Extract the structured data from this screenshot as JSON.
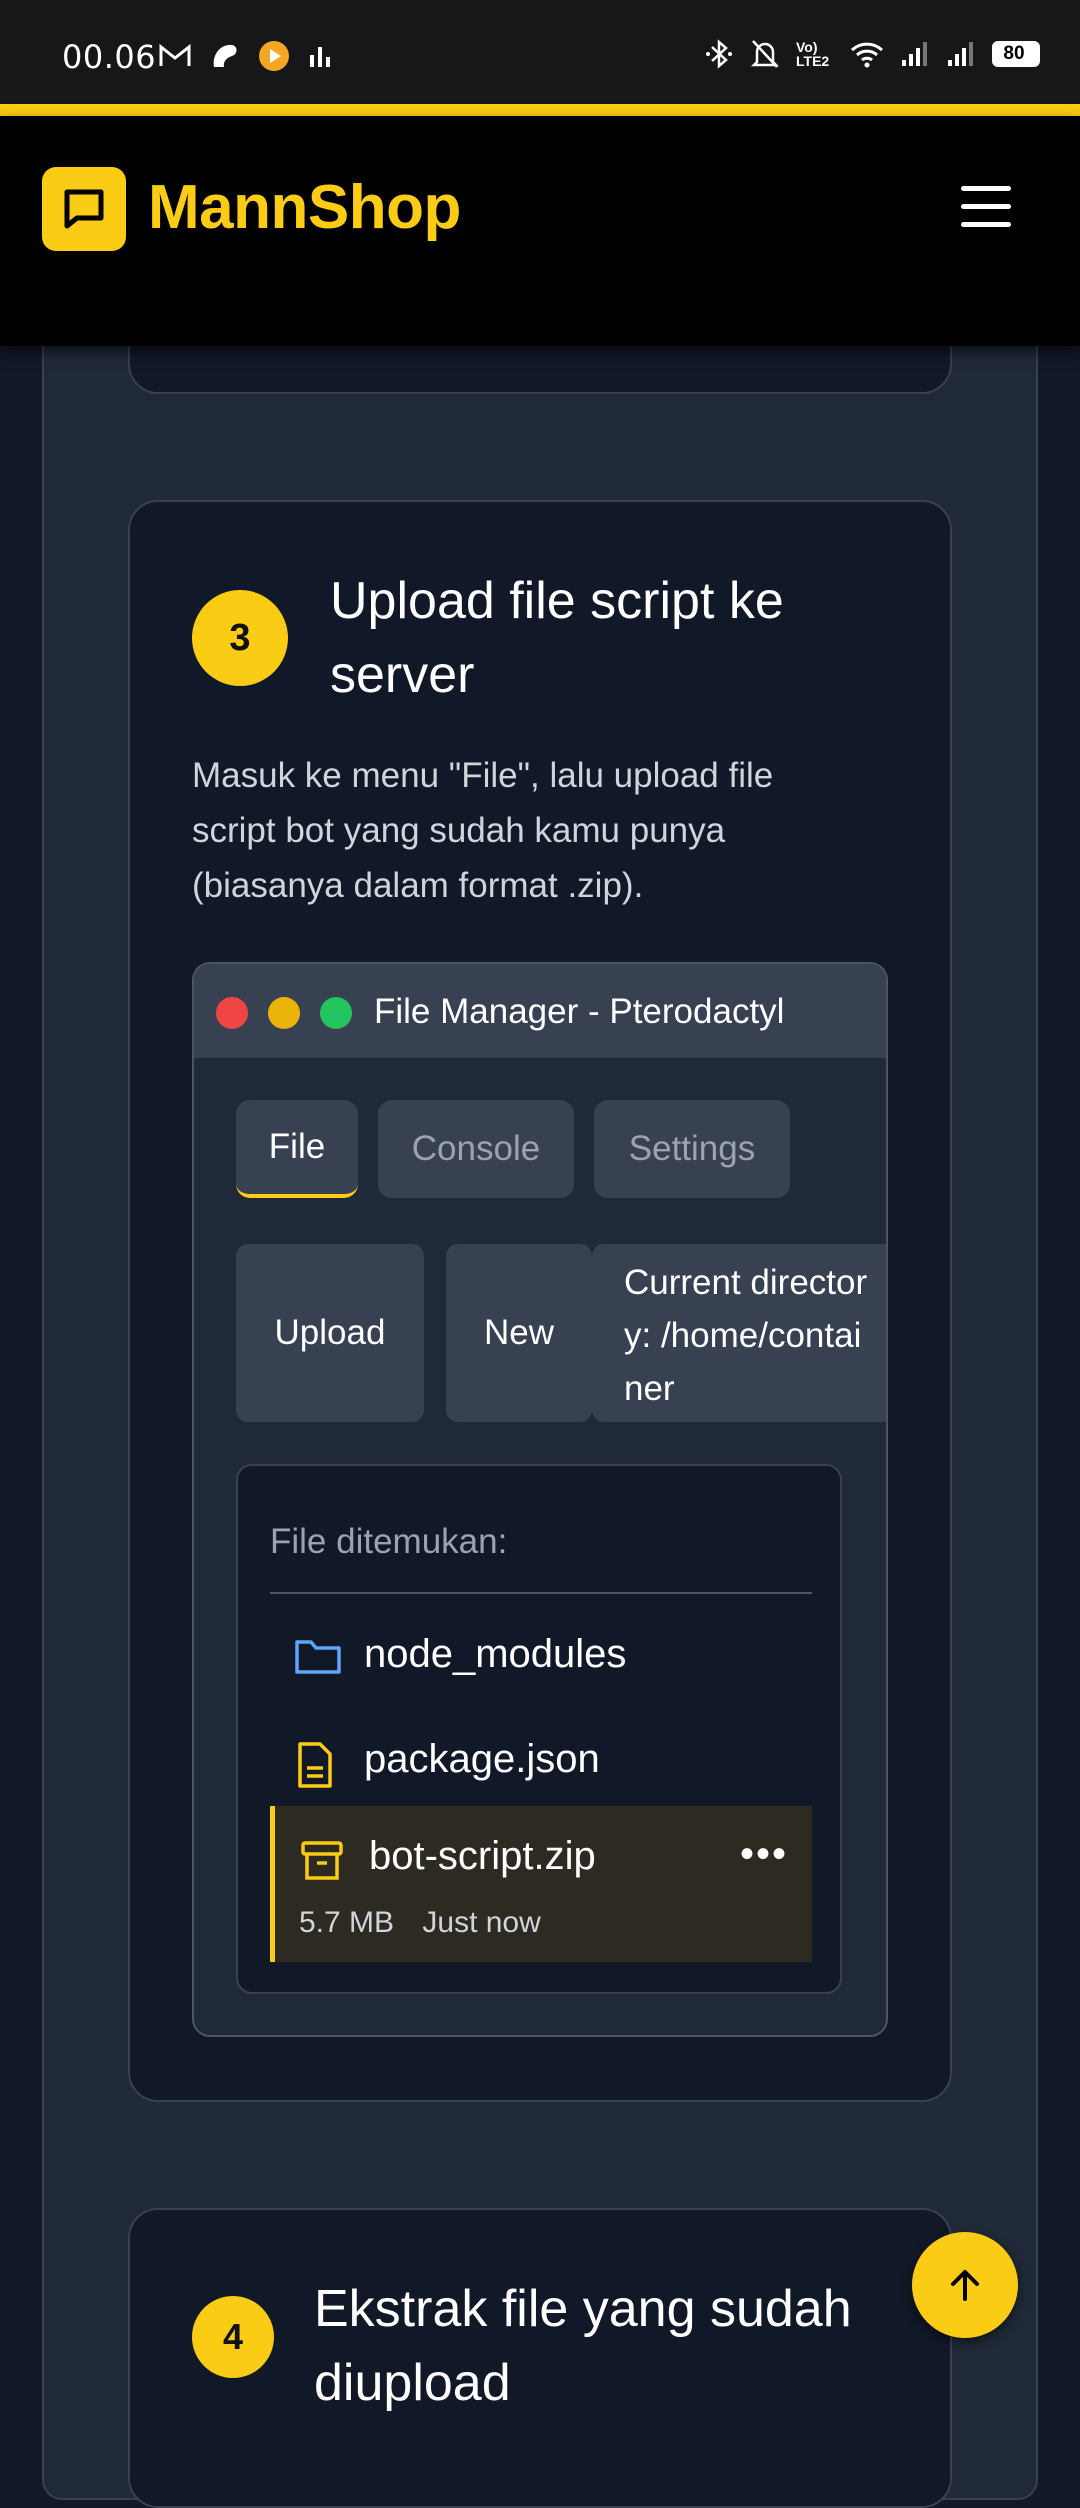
{
  "status_bar": {
    "time": "00.06",
    "battery": "80",
    "network_label": "Vo) LTE2",
    "left_icons": [
      "gmail-icon",
      "app-icon",
      "media-icon",
      "equalizer-icon"
    ],
    "right_icons": [
      "bluetooth-icon",
      "mute-icon",
      "volte-icon",
      "wifi-icon",
      "signal-icon",
      "signal-icon",
      "battery-icon"
    ]
  },
  "header": {
    "brand": "MannShop",
    "logo_icon": "chat-icon",
    "menu_icon": "hamburger-icon"
  },
  "step3": {
    "number": "3",
    "title": "Upload file script ke server",
    "description": "Masuk ke menu \"File\", lalu upload file script bot yang sudah kamu punya (biasanya dalam format .zip)."
  },
  "file_manager": {
    "title": "File Manager - Pterodactyl",
    "tabs": [
      "File",
      "Console",
      "Settings"
    ],
    "active_tab": "File",
    "actions": {
      "upload": "Upload",
      "new": "New",
      "directory": "Current directory: /home/container"
    },
    "list_label": "File ditemukan:",
    "files": [
      {
        "name": "node_modules",
        "icon": "folder-icon"
      },
      {
        "name": "package.json",
        "icon": "file-icon"
      },
      {
        "name": "bot-script.zip",
        "icon": "archive-icon",
        "size": "5.7 MB",
        "time": "Just now",
        "selected": true
      }
    ]
  },
  "step4": {
    "number": "4",
    "title": "Ekstrak file yang sudah diupload"
  },
  "colors": {
    "accent": "#facc15",
    "background": "#111827",
    "panel": "#1f2937",
    "dot_red": "#ef4444",
    "dot_yellow": "#eab308",
    "dot_green": "#22c55e"
  }
}
